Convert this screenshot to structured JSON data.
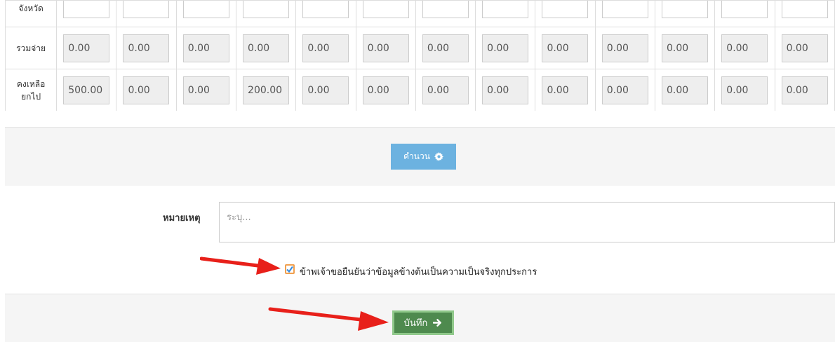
{
  "table": {
    "top_label": "จังหวัด",
    "rows": [
      {
        "label_lines": [
          "รวมจ่าย"
        ],
        "values": [
          "0.00",
          "0.00",
          "0.00",
          "0.00",
          "0.00",
          "0.00",
          "0.00",
          "0.00",
          "0.00",
          "0.00",
          "0.00",
          "0.00",
          "0.00"
        ]
      },
      {
        "label_lines": [
          "คงเหลือ",
          "ยกไป"
        ],
        "values": [
          "500.00",
          "0.00",
          "0.00",
          "200.00",
          "0.00",
          "0.00",
          "0.00",
          "0.00",
          "0.00",
          "0.00",
          "0.00",
          "0.00",
          "0.00"
        ]
      }
    ]
  },
  "calc_button": {
    "label": "คำนวน",
    "icon": "gear-icon"
  },
  "note": {
    "label": "หมายเหตุ",
    "placeholder": "ระบุ..."
  },
  "confirm": {
    "label": "ข้าพเจ้าขอยืนยันว่าข้อมูลข้างต้นเป็นความเป็นจริงทุกประการ",
    "checked": true
  },
  "save_button": {
    "label": "บันทึก",
    "icon": "arrow-right-icon"
  },
  "colors": {
    "calc_button": "#6cb2e0",
    "save_button": "#4e8a4e",
    "annotation_arrow": "#e8201a",
    "checkbox_check": "#3a8ee0"
  }
}
